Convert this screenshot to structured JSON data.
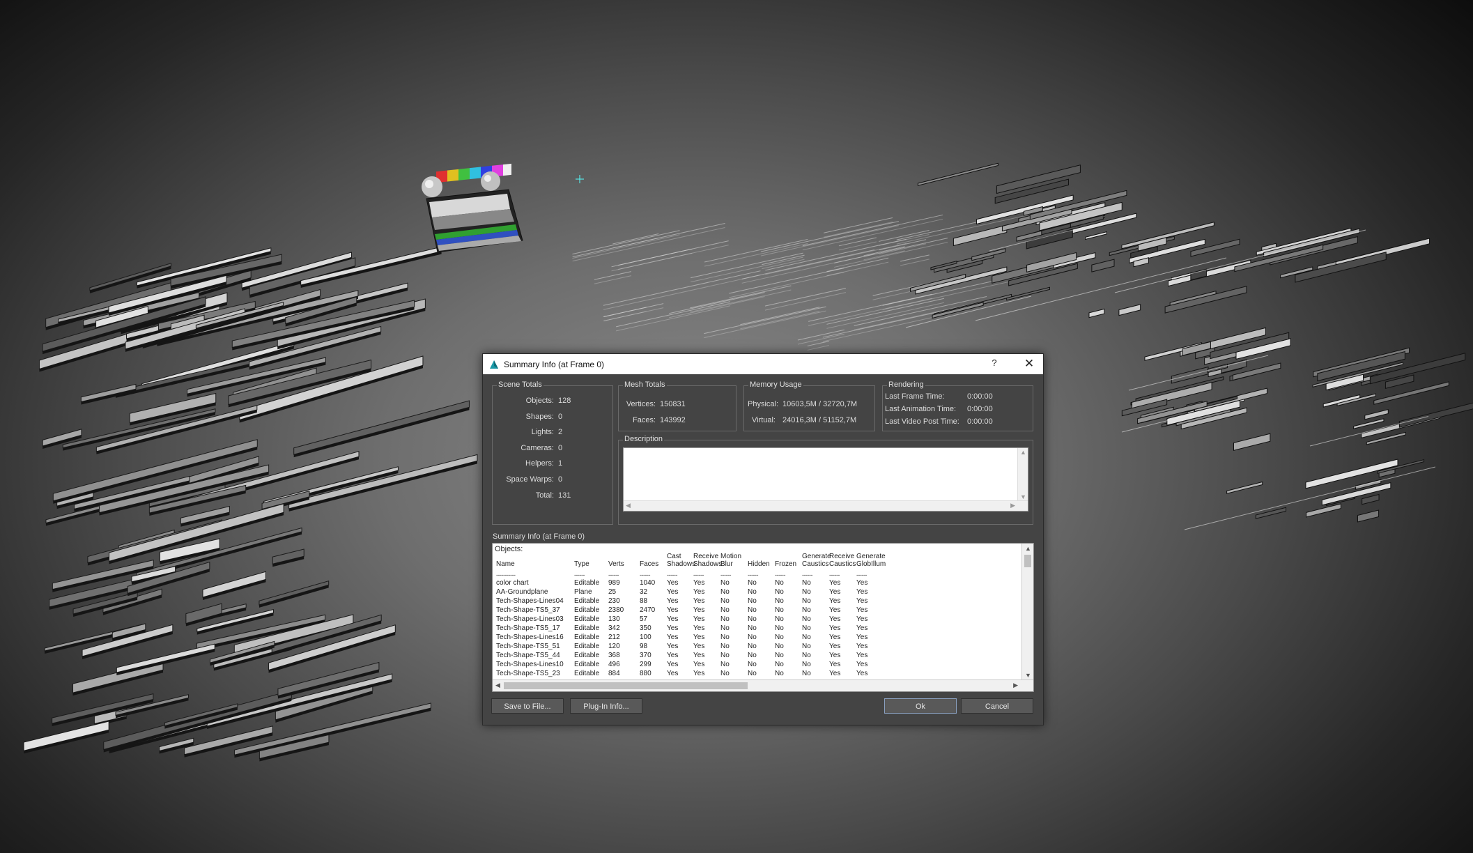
{
  "dialog": {
    "title": "Summary Info (at Frame 0)",
    "help_label": "?",
    "close_label": "✕",
    "icon": "3dsmax-app-icon"
  },
  "scene_totals": {
    "title": "Scene Totals",
    "rows": [
      {
        "label": "Objects:",
        "value": "128"
      },
      {
        "label": "Shapes:",
        "value": "0"
      },
      {
        "label": "Lights:",
        "value": "2"
      },
      {
        "label": "Cameras:",
        "value": "0"
      },
      {
        "label": "Helpers:",
        "value": "1"
      },
      {
        "label": "Space Warps:",
        "value": "0"
      },
      {
        "label": "Total:",
        "value": "131"
      }
    ]
  },
  "mesh_totals": {
    "title": "Mesh Totals",
    "rows": [
      {
        "label": "Vertices:",
        "value": "150831"
      },
      {
        "label": "Faces:",
        "value": "143992"
      }
    ]
  },
  "memory_usage": {
    "title": "Memory Usage",
    "rows": [
      {
        "label": "Physical:",
        "value": "10603,5M / 32720,7M"
      },
      {
        "label": "Virtual:",
        "value": "24016,3M / 51152,7M"
      }
    ]
  },
  "rendering": {
    "title": "Rendering",
    "rows": [
      {
        "label": "Last Frame Time:",
        "value": "0:00:00"
      },
      {
        "label": "Last Animation Time:",
        "value": "0:00:00"
      },
      {
        "label": "Last Video Post Time:",
        "value": "0:00:00"
      }
    ]
  },
  "description": {
    "title": "Description",
    "value": ""
  },
  "summary": {
    "label": "Summary Info (at Frame 0)",
    "objects_label": "Objects:",
    "columns": [
      {
        "line1": "",
        "line2": "Name",
        "dash": "-----------"
      },
      {
        "line1": "",
        "line2": "Type",
        "dash": "------"
      },
      {
        "line1": "",
        "line2": "Verts",
        "dash": "------"
      },
      {
        "line1": "",
        "line2": "Faces",
        "dash": "------"
      },
      {
        "line1": "Cast",
        "line2": "Shadows",
        "dash": "------"
      },
      {
        "line1": "Receive",
        "line2": "Shadows",
        "dash": "------"
      },
      {
        "line1": "Motion",
        "line2": "Blur",
        "dash": "------"
      },
      {
        "line1": "",
        "line2": "Hidden",
        "dash": "------"
      },
      {
        "line1": "",
        "line2": "Frozen",
        "dash": "------"
      },
      {
        "line1": "Generate",
        "line2": "Caustics",
        "dash": "------"
      },
      {
        "line1": "Receive",
        "line2": "Caustics",
        "dash": "------"
      },
      {
        "line1": "Generate",
        "line2": "GlobIllum",
        "dash": "------"
      }
    ],
    "rows": [
      [
        "color chart",
        "Editable",
        "989",
        "1040",
        "Yes",
        "Yes",
        "No",
        "No",
        "No",
        "No",
        "Yes",
        "Yes"
      ],
      [
        "AA-Groundplane",
        "Plane",
        "25",
        "32",
        "Yes",
        "Yes",
        "No",
        "No",
        "No",
        "No",
        "Yes",
        "Yes"
      ],
      [
        "Tech-Shapes-Lines04",
        "Editable",
        "230",
        "88",
        "Yes",
        "Yes",
        "No",
        "No",
        "No",
        "No",
        "Yes",
        "Yes"
      ],
      [
        "Tech-Shape-TS5_37",
        "Editable",
        "2380",
        "2470",
        "Yes",
        "Yes",
        "No",
        "No",
        "No",
        "No",
        "Yes",
        "Yes"
      ],
      [
        "Tech-Shapes-Lines03",
        "Editable",
        "130",
        "57",
        "Yes",
        "Yes",
        "No",
        "No",
        "No",
        "No",
        "Yes",
        "Yes"
      ],
      [
        "Tech-Shape-TS5_17",
        "Editable",
        "342",
        "350",
        "Yes",
        "Yes",
        "No",
        "No",
        "No",
        "No",
        "Yes",
        "Yes"
      ],
      [
        "Tech-Shapes-Lines16",
        "Editable",
        "212",
        "100",
        "Yes",
        "Yes",
        "No",
        "No",
        "No",
        "No",
        "Yes",
        "Yes"
      ],
      [
        "Tech-Shape-TS5_51",
        "Editable",
        "120",
        "98",
        "Yes",
        "Yes",
        "No",
        "No",
        "No",
        "No",
        "Yes",
        "Yes"
      ],
      [
        "Tech-Shape-TS5_44",
        "Editable",
        "368",
        "370",
        "Yes",
        "Yes",
        "No",
        "No",
        "No",
        "No",
        "Yes",
        "Yes"
      ],
      [
        "Tech-Shapes-Lines10",
        "Editable",
        "496",
        "299",
        "Yes",
        "Yes",
        "No",
        "No",
        "No",
        "No",
        "Yes",
        "Yes"
      ],
      [
        "Tech-Shape-TS5_23",
        "Editable",
        "884",
        "880",
        "Yes",
        "Yes",
        "No",
        "No",
        "No",
        "No",
        "Yes",
        "Yes"
      ]
    ]
  },
  "buttons": {
    "save": "Save to File...",
    "plugin": "Plug-In Info...",
    "ok": "Ok",
    "cancel": "Cancel"
  },
  "colors": {
    "dialog_bg": "#444444",
    "list_bg": "#ffffff",
    "viewport_center": "#8a8a8a",
    "viewport_edge": "#0c0c0c"
  }
}
